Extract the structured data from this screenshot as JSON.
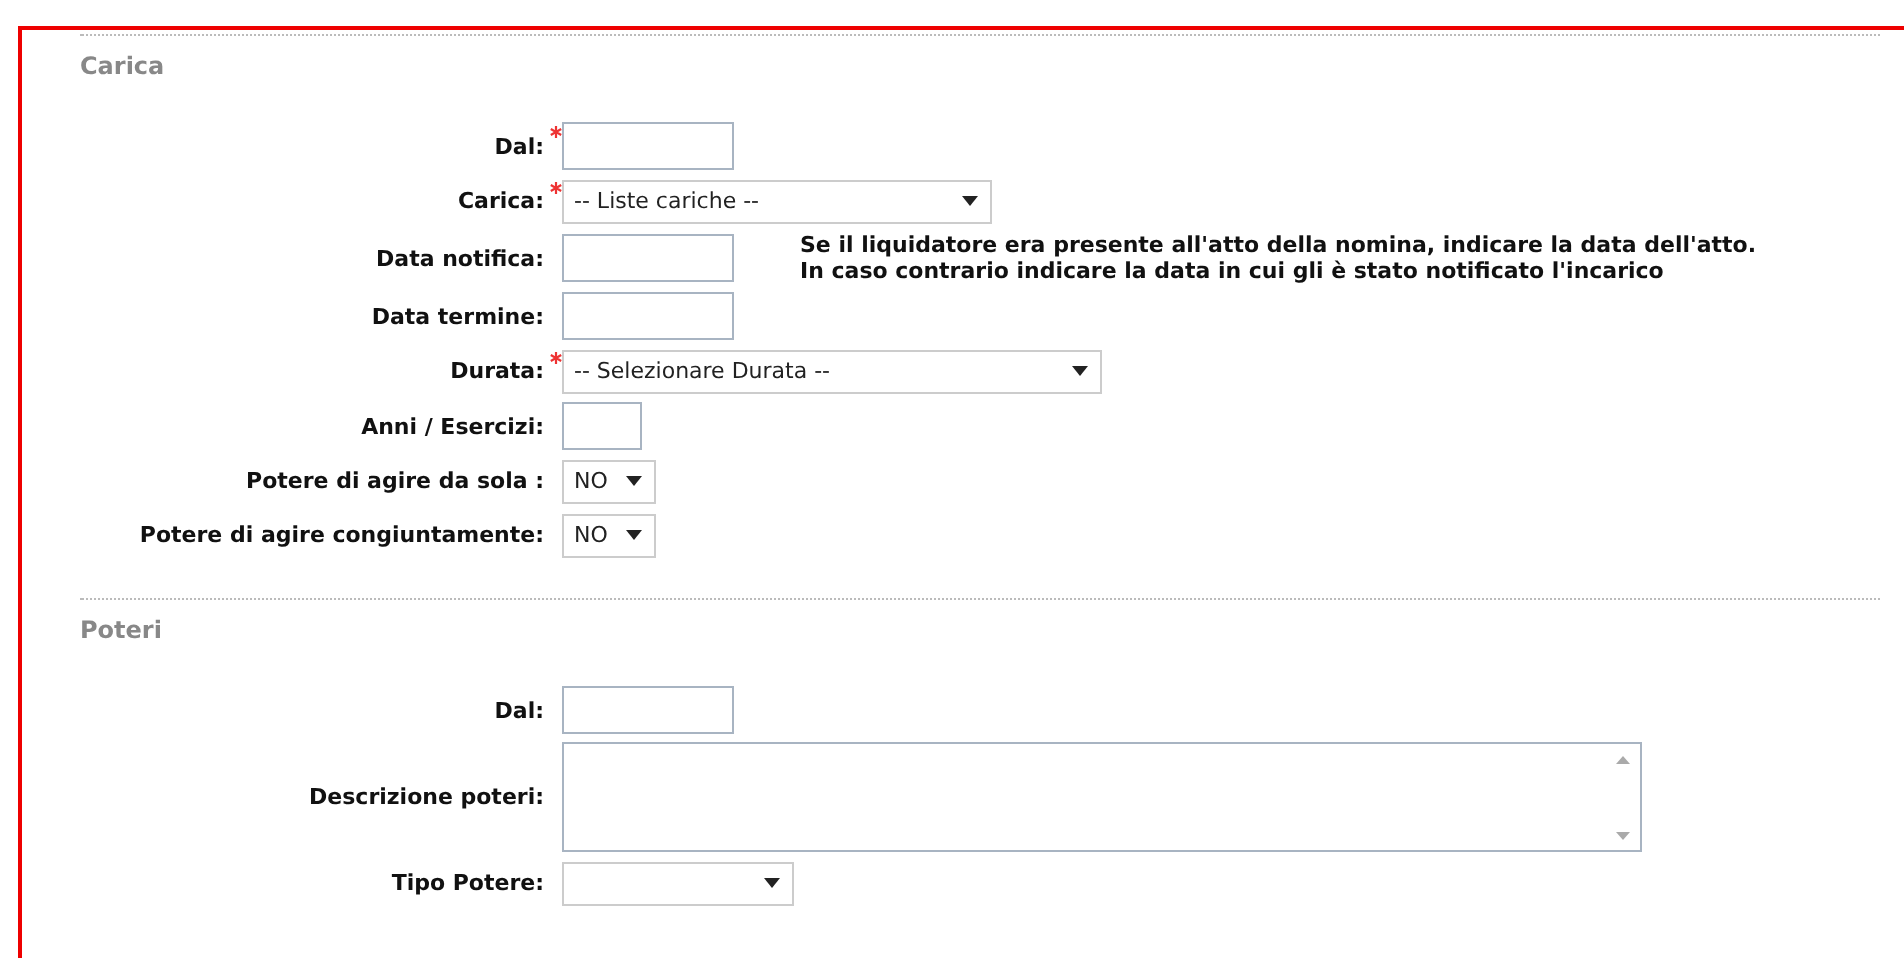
{
  "sections": [
    {
      "title": "Carica",
      "rows": [
        {
          "label": "Dal:",
          "required": true,
          "kind": "date"
        },
        {
          "label": "Carica:",
          "required": true,
          "kind": "select",
          "value": "-- Liste cariche --"
        },
        {
          "label": "Data notifica:",
          "required": false,
          "kind": "date",
          "note": "Se il liquidatore era presente all'atto della nomina, indicare la data dell'atto.\nIn caso contrario indicare la data in cui gli è stato notificato l'incarico"
        },
        {
          "label": "Data termine:",
          "required": false,
          "kind": "date"
        },
        {
          "label": "Durata:",
          "required": true,
          "kind": "select",
          "value": "-- Selezionare Durata --"
        },
        {
          "label": "Anni / Esercizi:",
          "required": false,
          "kind": "number"
        },
        {
          "label": "Potere di agire da sola :",
          "required": false,
          "kind": "select",
          "value": "NO"
        },
        {
          "label": "Potere di agire congiuntamente:",
          "required": false,
          "kind": "select",
          "value": "NO"
        }
      ]
    },
    {
      "title": "Poteri",
      "rows": [
        {
          "label": "Dal:",
          "required": false,
          "kind": "date"
        },
        {
          "label": "Descrizione poteri:",
          "required": false,
          "kind": "textarea"
        },
        {
          "label": "Tipo Potere:",
          "required": false,
          "kind": "select"
        }
      ]
    }
  ]
}
